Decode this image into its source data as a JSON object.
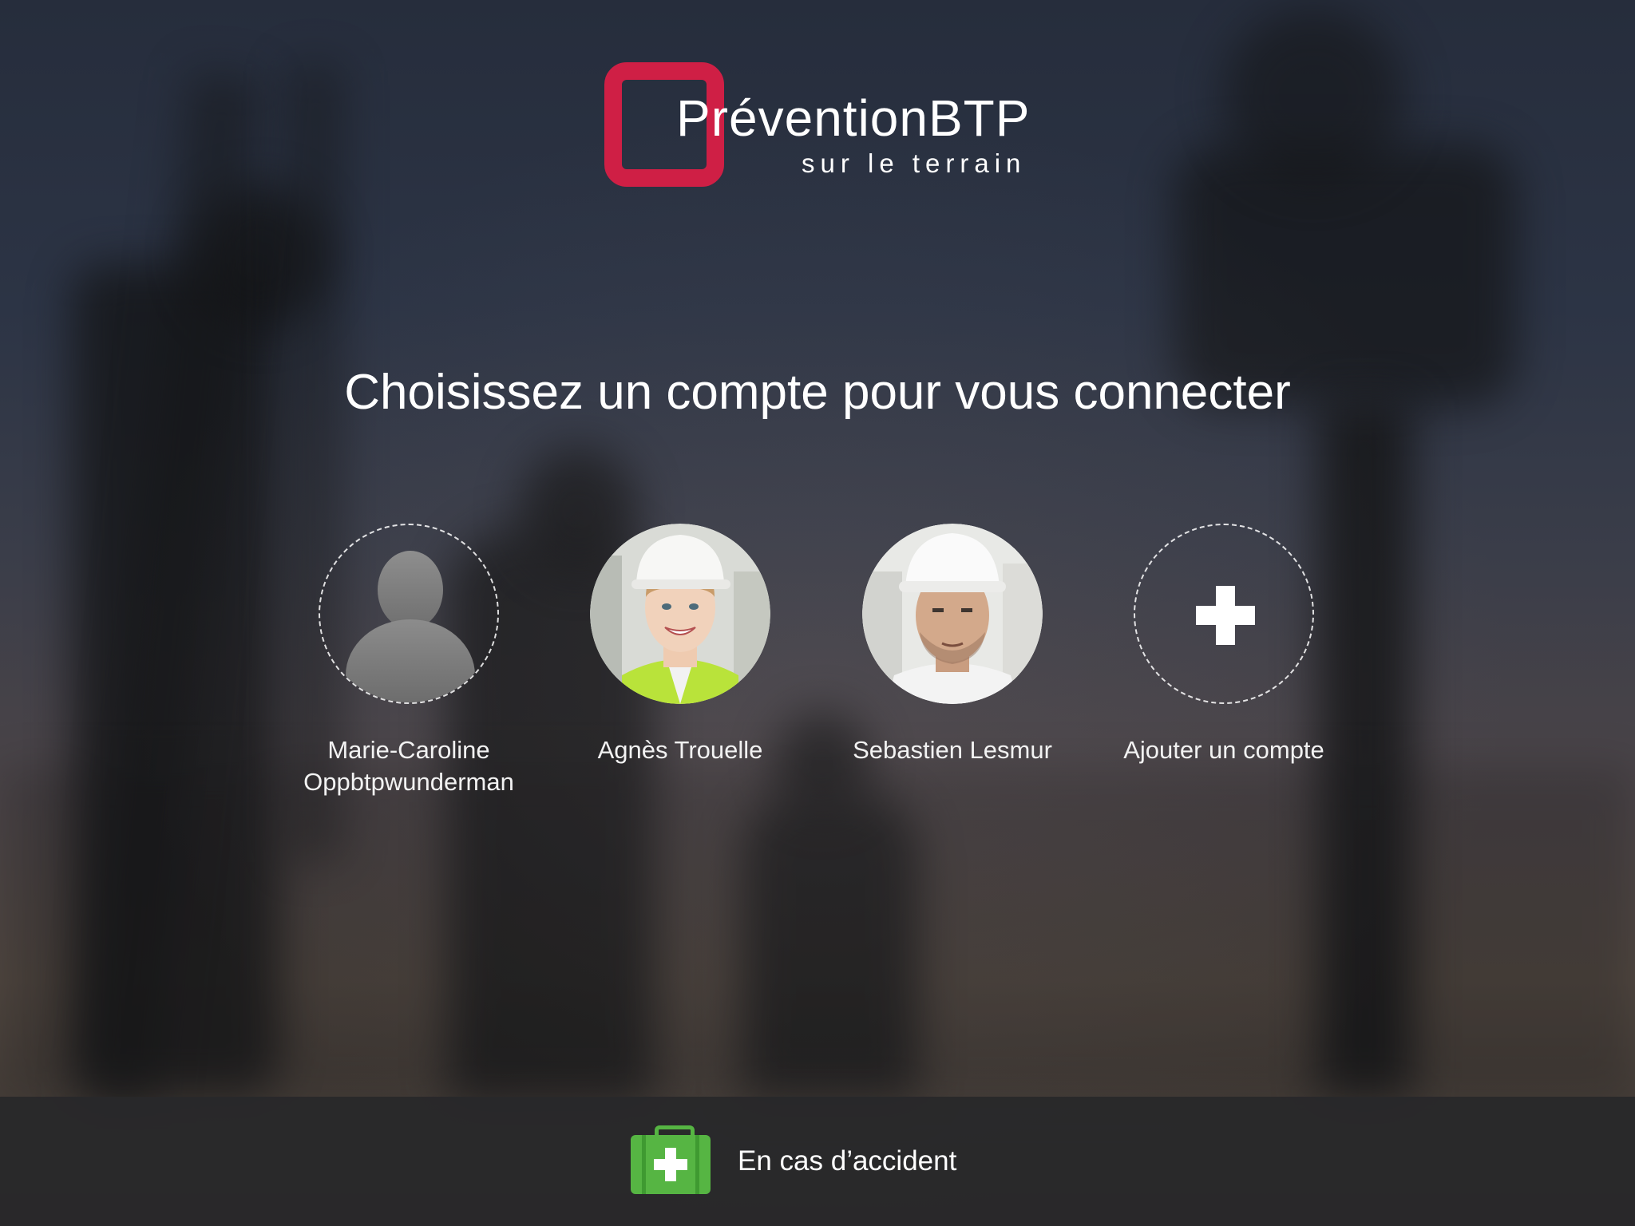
{
  "logo": {
    "title": "PréventionBTP",
    "subtitle": "sur le terrain",
    "brand_color": "#cf1f45"
  },
  "headline": "Choisissez un compte pour vous connecter",
  "accounts": [
    {
      "name_line1": "Marie-Caroline",
      "name_line2": "Oppbtpwunderman",
      "avatar": "default-user-silhouette"
    },
    {
      "name_line1": "Agnès Trouelle",
      "avatar": "photo-woman-hardhat"
    },
    {
      "name_line1": "Sebastien Lesmur",
      "avatar": "photo-man-hardhat"
    },
    {
      "name_line1": "Ajouter un compte",
      "avatar": "plus-icon"
    }
  ],
  "bottom_bar": {
    "accident_label": "En cas d’accident",
    "icon": "first-aid-kit-icon",
    "icon_color": "#56b543"
  }
}
